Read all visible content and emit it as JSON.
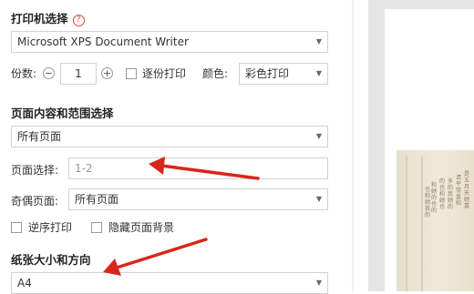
{
  "printer_section": {
    "title": "打印机选择",
    "help_icon": "?",
    "printer_value": "Microsoft XPS Document Writer"
  },
  "copies": {
    "label": "份数:",
    "minus": "−",
    "value": "1",
    "plus": "+",
    "collate_label": "逐份打印",
    "color_label": "颜色:",
    "color_value": "彩色打印"
  },
  "content_section": {
    "title": "页面内容和范围选择",
    "content_value": "所有页面",
    "page_select_label": "页面选择:",
    "page_select_placeholder": "1-2",
    "odd_even_label": "奇偶页面:",
    "odd_even_value": "所有页面",
    "reverse_label": "逆序打印",
    "hide_bg_label": "隐藏页面背景"
  },
  "paper_section": {
    "title": "纸张大小和方向",
    "size_value": "A4"
  },
  "preview": {
    "text_columns": [
      "是五月天她嘉",
      "请平常直和",
      "多的我她的",
      "的也和她也",
      "和她的也的",
      "也和她我的"
    ]
  },
  "colors": {
    "arrow": "#d9261c",
    "accent": "#e0463a"
  }
}
